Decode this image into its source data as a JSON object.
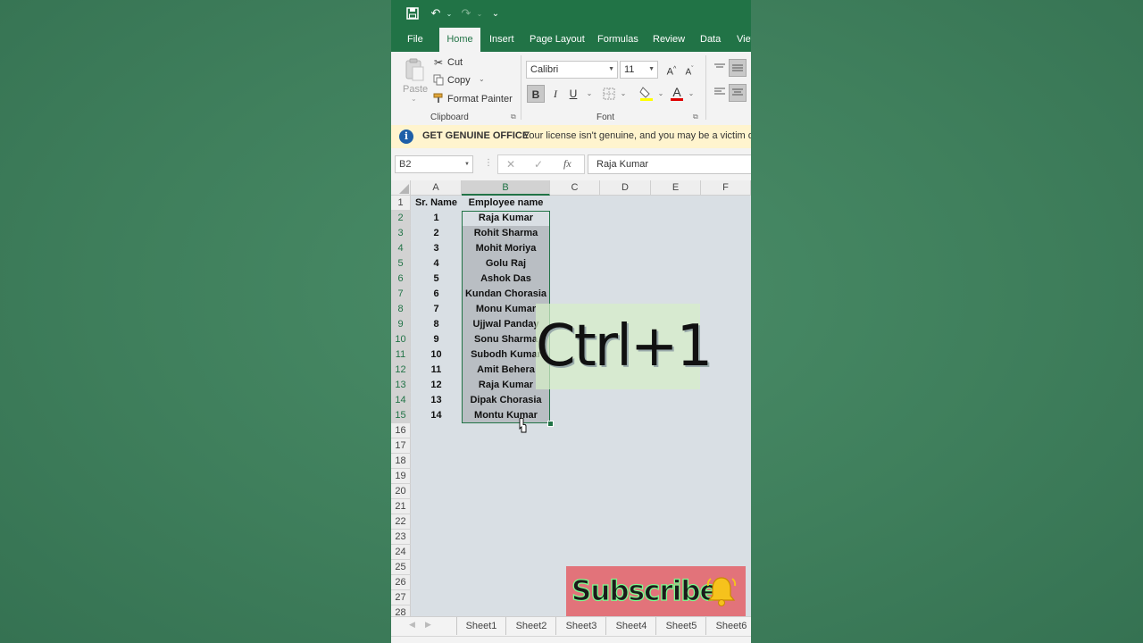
{
  "quick_access": {
    "save": "💾",
    "undo": "↶",
    "redo": "↷",
    "customize": "⌄"
  },
  "tabs": [
    {
      "label": "File"
    },
    {
      "label": "Home"
    },
    {
      "label": "Insert"
    },
    {
      "label": "Page Layout"
    },
    {
      "label": "Formulas"
    },
    {
      "label": "Review"
    },
    {
      "label": "Data"
    },
    {
      "label": "View"
    }
  ],
  "ribbon": {
    "clipboard": {
      "paste": "Paste",
      "cut": "Cut",
      "copy": "Copy",
      "format_painter": "Format Painter",
      "group_label": "Clipboard"
    },
    "font": {
      "font_name": "Calibri",
      "font_size": "11",
      "bold": "B",
      "italic": "I",
      "underline": "U",
      "group_label": "Font"
    }
  },
  "warning": {
    "title": "GET GENUINE OFFICE",
    "message": "Your license isn't genuine, and you may be a victim of s"
  },
  "formula_bar": {
    "name_box": "B2",
    "fx": "fx",
    "value": "Raja Kumar"
  },
  "columns": [
    "A",
    "B",
    "C",
    "D",
    "E",
    "F"
  ],
  "rows": [
    "1",
    "2",
    "3",
    "4",
    "5",
    "6",
    "7",
    "8",
    "9",
    "10",
    "11",
    "12",
    "13",
    "14",
    "15",
    "16",
    "17",
    "18",
    "19",
    "20",
    "21",
    "22",
    "23",
    "24",
    "25",
    "26",
    "27",
    "28"
  ],
  "header": {
    "a": "Sr. Name",
    "b": "Employee name"
  },
  "data": [
    {
      "sr": "1",
      "name": "Raja Kumar"
    },
    {
      "sr": "2",
      "name": "Rohit Sharma"
    },
    {
      "sr": "3",
      "name": "Mohit Moriya"
    },
    {
      "sr": "4",
      "name": "Golu Raj"
    },
    {
      "sr": "5",
      "name": "Ashok Das"
    },
    {
      "sr": "6",
      "name": "Kundan Chorasia"
    },
    {
      "sr": "7",
      "name": "Monu Kumar"
    },
    {
      "sr": "8",
      "name": "Ujjwal Panday"
    },
    {
      "sr": "9",
      "name": "Sonu Sharma"
    },
    {
      "sr": "10",
      "name": "Subodh Kumar"
    },
    {
      "sr": "11",
      "name": "Amit Behera"
    },
    {
      "sr": "12",
      "name": "Raja Kumar"
    },
    {
      "sr": "13",
      "name": "Dipak Chorasia"
    },
    {
      "sr": "14",
      "name": "Montu Kumar"
    }
  ],
  "sheets": [
    "Sheet1",
    "Sheet2",
    "Sheet3",
    "Sheet4",
    "Sheet5",
    "Sheet6"
  ],
  "overlay": {
    "shortcut": "Ctrl+1",
    "subscribe": "Subscribe"
  },
  "colors": {
    "excel_green": "#217346",
    "background": "#3f7f5c",
    "subscribe_bg": "#e2737a"
  }
}
